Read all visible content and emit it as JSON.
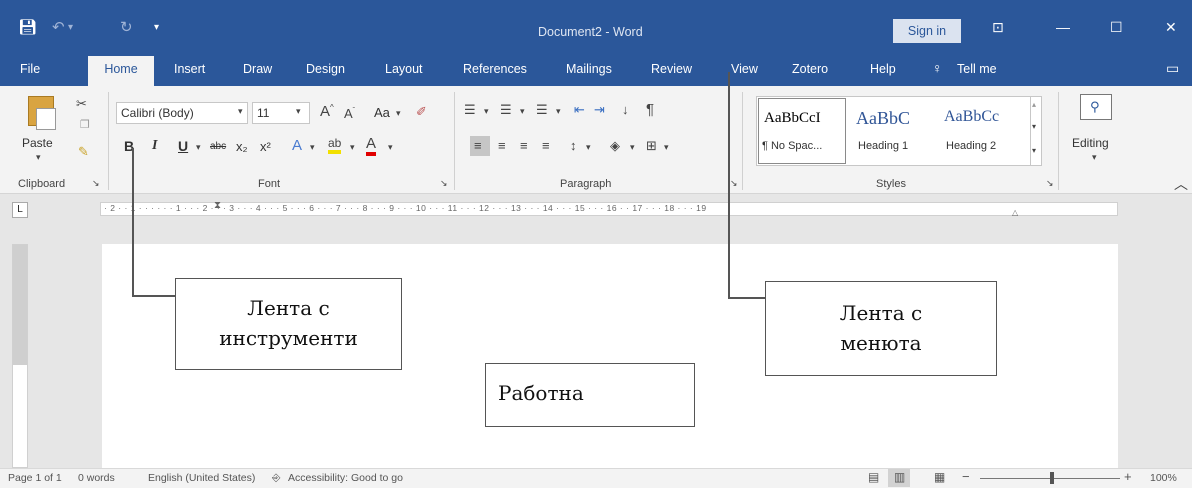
{
  "titlebar": {
    "title": "Document2  -  Word",
    "signin": "Sign in"
  },
  "tabs": [
    "File",
    "Home",
    "Insert",
    "Draw",
    "Design",
    "Layout",
    "References",
    "Mailings",
    "Review",
    "View",
    "Zotero",
    "Help",
    "Tell me"
  ],
  "ribbon": {
    "clipboard": {
      "paste": "Paste",
      "label": "Clipboard"
    },
    "font": {
      "name": "Calibri (Body)",
      "size": "11",
      "case": "Aa",
      "label": "Font",
      "bold": "B",
      "italic": "I",
      "underline": "U",
      "strike": "abc",
      "sub": "x₂",
      "sup": "x²"
    },
    "paragraph": {
      "label": "Paragraph"
    },
    "styles": {
      "items": [
        {
          "preview": "AaBbCcI",
          "name": "¶ No Spac..."
        },
        {
          "preview": "AaBbC",
          "name": "Heading 1"
        },
        {
          "preview": "AaBbCc",
          "name": "Heading 2"
        }
      ],
      "label": "Styles"
    },
    "editing": {
      "label": "Editing"
    }
  },
  "ruler": "· 2 · · 1 · · ·    · · · 1 · · · 2 · · · 3 · · · 4 · · · 5 · · · 6 · · · 7 · · · 8 · · · 9 · · · 10 · · · 11 · · · 12 · · · 13 · · · 14 · · · 15 · · · 16 ·    · 17 · · · 18 · · · 19",
  "status": {
    "page": "Page 1 of 1",
    "words": "0 words",
    "language": "English (United States)",
    "accessibility": "Accessibility: Good to go",
    "zoom": "100%"
  },
  "annotations": {
    "tools_line1": "Лента с",
    "tools_line2": "инструменти",
    "menus_line1": "Лента с",
    "menus_line2": "менюта",
    "workspace": "Работна"
  },
  "colors": {
    "accent": "#2b579a",
    "ribbon_bg": "#f3f3f3"
  }
}
